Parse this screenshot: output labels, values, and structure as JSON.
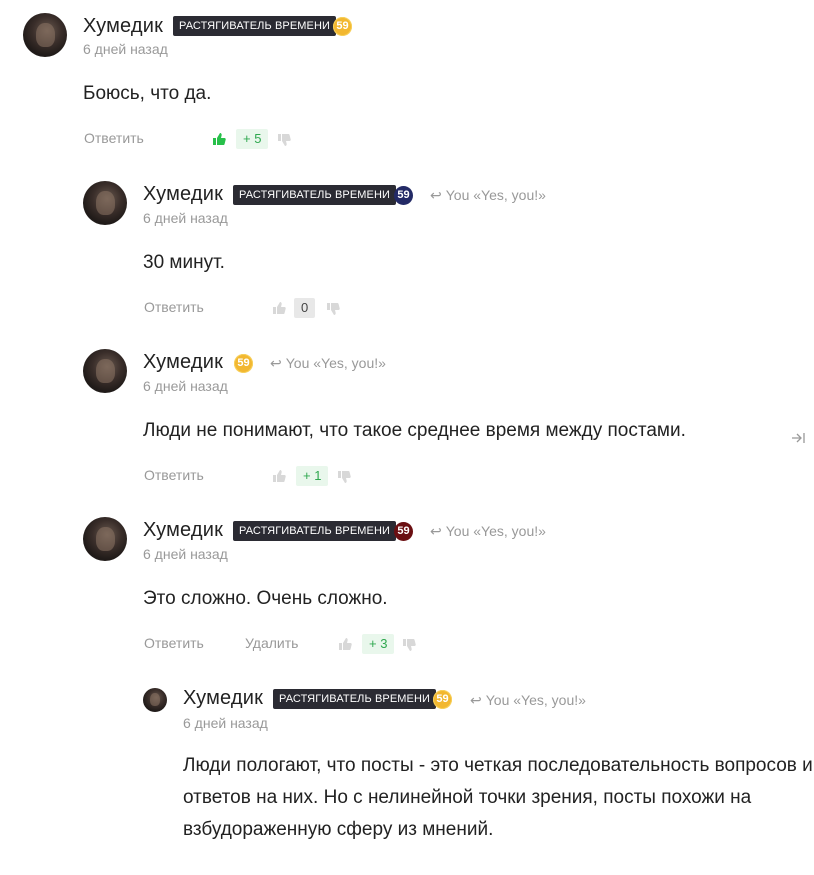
{
  "colors": {
    "badge_bg": "#2b2b33",
    "level_gold": "#f2b730",
    "level_navy": "#232a66",
    "level_maroon": "#6b0f12",
    "upvote_active": "#27c04a",
    "score_positive": "#2fa84f"
  },
  "comments": [
    {
      "author": "Хумедик",
      "badge": "РАСТЯГИВАТЕЛЬ ВРЕМЕНИ",
      "level": "59",
      "level_color": "gold",
      "reply_to": "",
      "date": "6 дней назад",
      "text": [
        "Боюсь, что да."
      ],
      "actions": [
        "Ответить"
      ],
      "score": "+ 5",
      "upvoted": true
    },
    {
      "author": "Хумедик",
      "badge": "РАСТЯГИВАТЕЛЬ ВРЕМЕНИ",
      "level": "59",
      "level_color": "navy",
      "reply_to": "You «Yes, you!»",
      "date": "6 дней назад",
      "text": [
        "30 минут."
      ],
      "actions": [
        "Ответить"
      ],
      "score": "0",
      "upvoted": false
    },
    {
      "author": "Хумедик",
      "badge": "",
      "level": "59",
      "level_color": "gold",
      "reply_to": "You «Yes, you!»",
      "date": "6 дней назад",
      "text": [
        "Люди не понимают, что такое среднее время между постами."
      ],
      "actions": [
        "Ответить"
      ],
      "score": "+ 1",
      "upvoted": false
    },
    {
      "author": "Хумедик",
      "badge": "РАСТЯГИВАТЕЛЬ ВРЕМЕНИ",
      "level": "59",
      "level_color": "maroon",
      "reply_to": "You «Yes, you!»",
      "date": "6 дней назад",
      "text": [
        "Это сложно. Очень сложно."
      ],
      "actions": [
        "Ответить",
        "Удалить"
      ],
      "score": "+ 3",
      "upvoted": false
    },
    {
      "author": "Хумедик",
      "badge": "РАСТЯГИВАТЕЛЬ ВРЕМЕНИ",
      "level": "59",
      "level_color": "gold",
      "reply_to": "You «Yes, you!»",
      "date": "6 дней назад",
      "text": [
        "Люди пологают, что посты - это четкая последовательность вопросов и",
        "ответов на них. Но с нелинейной точки зрения, посты похожи на",
        "взбудораженную сферу из мнений."
      ],
      "actions": [],
      "score": "",
      "upvoted": false
    }
  ],
  "icons": {
    "reply_arrow": "reply-arrow-icon",
    "upvote": "thumbs-up-icon",
    "downvote": "thumbs-down-icon",
    "expand": "expand-arrow-icon"
  }
}
